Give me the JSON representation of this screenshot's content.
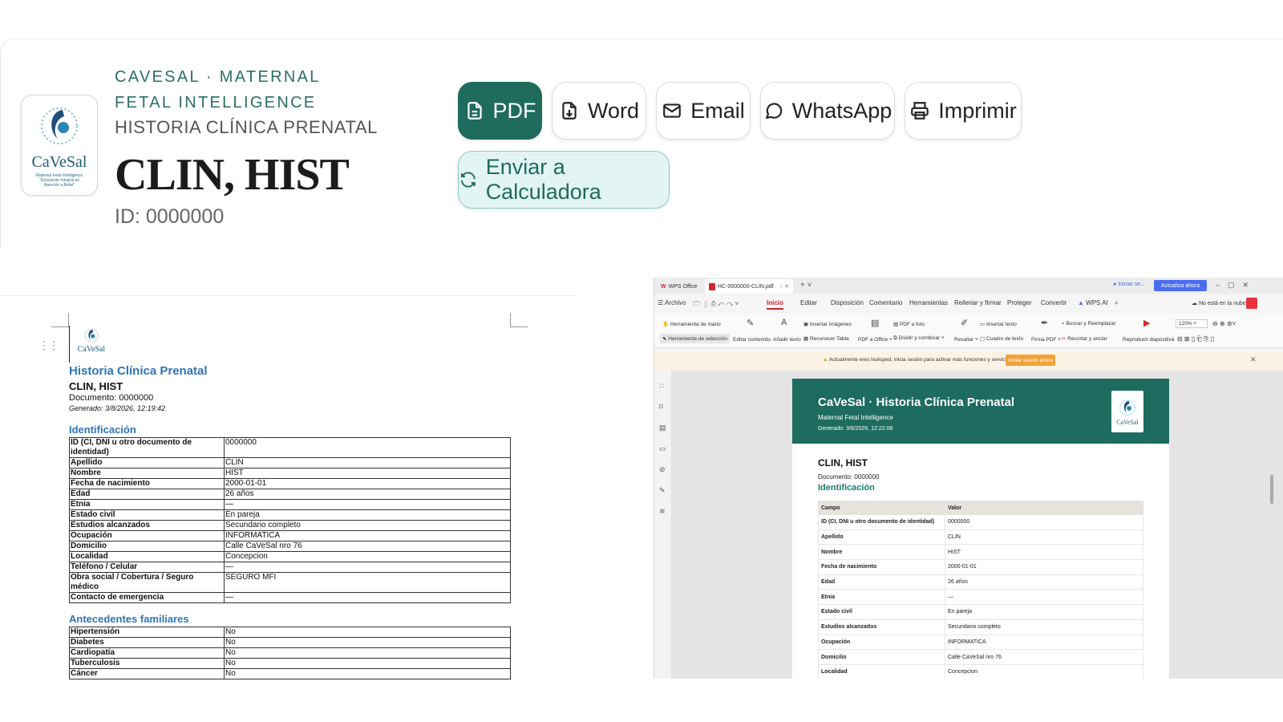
{
  "header": {
    "brand": "CAVESAL · MATERNAL FETAL INTELLIGENCE",
    "subtitle": "HISTORIA CLÍNICA PRENATAL",
    "patient_name": "CLIN, HIST",
    "patient_id": "ID: 0000000",
    "logo_text": "CaVeSal",
    "logo_caption": "Maternal Fetal Intelligence \"Educación Integral en Atención a Bebé\""
  },
  "actions": {
    "pdf": "PDF",
    "word": "Word",
    "email": "Email",
    "whatsapp": "WhatsApp",
    "print": "Imprimir",
    "calc": "Enviar a Calculadora",
    "accent_color": "#1f6b5e"
  },
  "word_doc": {
    "logo_text": "CaVeSal",
    "title": "Historia Clínica Prenatal",
    "name": "CLIN, HIST",
    "document": "Documento: 0000000",
    "generated": "Generado: 3/8/2026, 12:19:42",
    "section_identificacion": "Identificación",
    "identificacion": [
      {
        "label": "ID (CI, DNI u otro documento de identidad)",
        "value": "0000000"
      },
      {
        "label": "Apellido",
        "value": "CLIN"
      },
      {
        "label": "Nombre",
        "value": "HIST"
      },
      {
        "label": "Fecha de nacimiento",
        "value": "2000-01-01"
      },
      {
        "label": "Edad",
        "value": "26 años"
      },
      {
        "label": "Etnia",
        "value": "—"
      },
      {
        "label": "Estado civil",
        "value": "En pareja"
      },
      {
        "label": "Estudios alcanzados",
        "value": "Secundario completo"
      },
      {
        "label": "Ocupación",
        "value": "INFORMATICA"
      },
      {
        "label": "Domicilio",
        "value": "Calle CaVeSal nro 76"
      },
      {
        "label": "Localidad",
        "value": "Concepcion"
      },
      {
        "label": "Teléfono / Celular",
        "value": "—"
      },
      {
        "label": "Obra social / Cobertura / Seguro médico",
        "value": "SEGURO MFI"
      },
      {
        "label": "Contacto de emergencia",
        "value": "—"
      }
    ],
    "section_antecedentes": "Antecedentes familiares",
    "antecedentes": [
      {
        "label": "Hipertensión",
        "value": "No"
      },
      {
        "label": "Diabetes",
        "value": "No"
      },
      {
        "label": "Cardiopatía",
        "value": "No"
      },
      {
        "label": "Tuberculosis",
        "value": "No"
      },
      {
        "label": "Cáncer",
        "value": "No"
      }
    ]
  },
  "wps": {
    "app_tab": "WPS Office",
    "file_tab": "HC-0000000-CLIN.pdf",
    "login": "Iniciar se...",
    "upgrade": "Actualiza ahora",
    "menus": [
      "Archivo",
      "Inicio",
      "Editar",
      "Disposición",
      "Comentario",
      "Herramientas",
      "Rellenar y firmar",
      "Proteger",
      "Convertir",
      "WPS AI"
    ],
    "cloud": "No está en la nube",
    "ribbon": {
      "hand": "Herramienta de mano",
      "select": "Herramienta de selección",
      "edit_content": "Editar contenido",
      "add_text": "Añadir texto",
      "insert_images": "Insertar imágenes",
      "recognize_table": "Reconocer Tabla",
      "pdf_to_office": "PDF a Office",
      "pdf_to_photo": "PDF a foto",
      "split_merge": "Dividir y combinar",
      "highlight": "Resaltar",
      "insert_text": "Insertar texto",
      "text_box": "Cuadro de texto",
      "sign_pdf": "Firma PDF",
      "search_replace": "Buscar y Reemplazar",
      "crop_cut": "Recortar y anclar",
      "play_slides": "Reproducir diapositiva",
      "zoom": "120%"
    },
    "notice": "Actualmente eres huésped, inicia sesión para activar más funciones y servicios.",
    "notice_btn": "Iniciar sesión ahora",
    "pdf": {
      "title": "CaVeSal · Historia Clínica Prenatal",
      "subtitle": "Maternal Fetal Intelligence",
      "generated": "Generado: 3/8/2026, 12:22:06",
      "logo_text": "CaVeSal",
      "name": "CLIN, HIST",
      "document": "Documento: 0000000",
      "section": "Identificación",
      "col_field": "Campo",
      "col_value": "Valor",
      "rows": [
        {
          "label": "ID (CI, DNI u otro documento de identidad)",
          "value": "0000000"
        },
        {
          "label": "Apellido",
          "value": "CLIN"
        },
        {
          "label": "Nombre",
          "value": "HIST"
        },
        {
          "label": "Fecha de nacimiento",
          "value": "2000-01-01"
        },
        {
          "label": "Edad",
          "value": "26 años"
        },
        {
          "label": "Etnia",
          "value": "—"
        },
        {
          "label": "Estado civil",
          "value": "En pareja"
        },
        {
          "label": "Estudios alcanzados",
          "value": "Secundario completo"
        },
        {
          "label": "Ocupación",
          "value": "INFORMATICA"
        },
        {
          "label": "Domicilio",
          "value": "Calle CaVeSal nro 76"
        },
        {
          "label": "Localidad",
          "value": "Concepcion"
        }
      ]
    }
  }
}
